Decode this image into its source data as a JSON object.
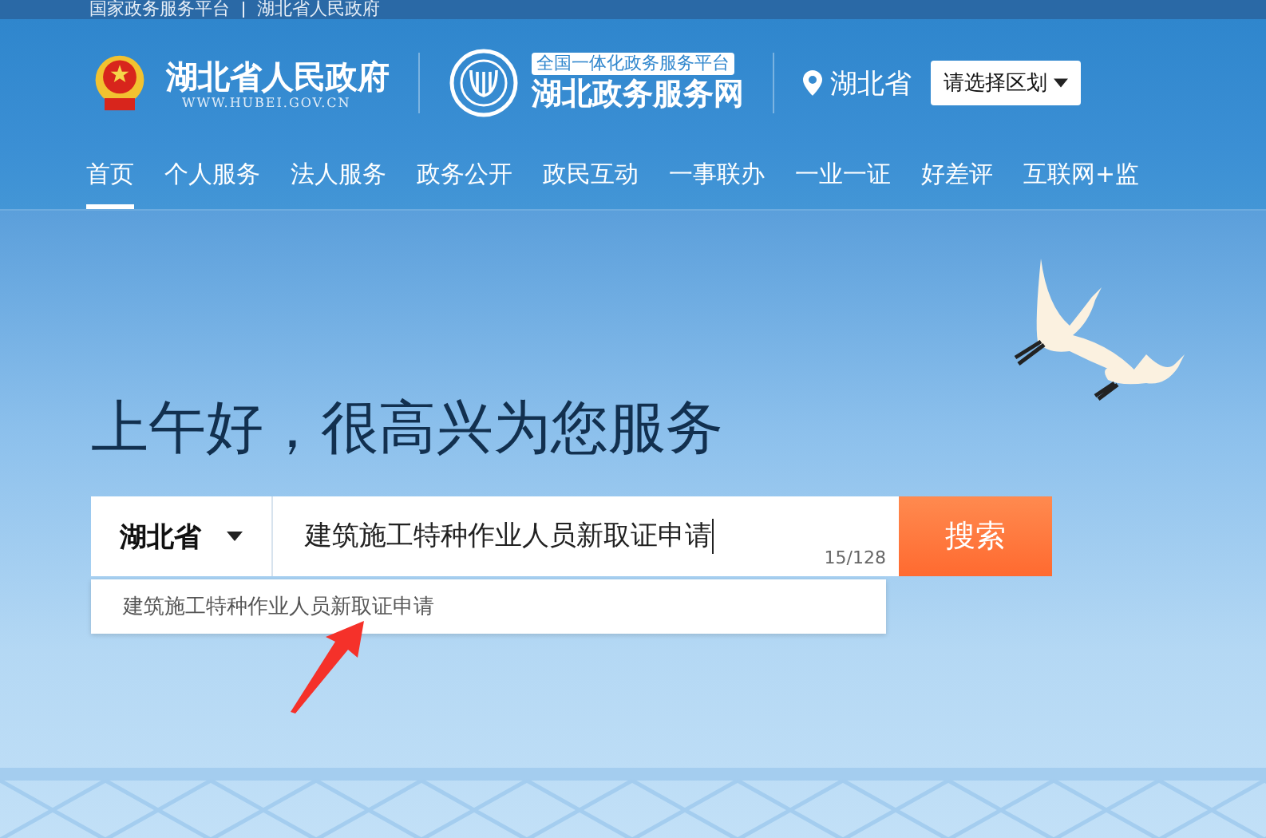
{
  "top_bar": {
    "links": [
      "国家政务服务平台",
      "湖北省人民政府"
    ]
  },
  "header": {
    "gov_name": "湖北省人民政府",
    "gov_url": "WWW.HUBEI.GOV.CN",
    "platform_tag": "全国一体化政务服务平台",
    "platform_name": "湖北政务服务网",
    "location": "湖北省",
    "region_select": "请选择区划"
  },
  "nav": [
    {
      "label": "首页",
      "selected": true
    },
    {
      "label": "个人服务",
      "selected": false
    },
    {
      "label": "法人服务",
      "selected": false
    },
    {
      "label": "政务公开",
      "selected": false
    },
    {
      "label": "政民互动",
      "selected": false
    },
    {
      "label": "一事联办",
      "selected": false
    },
    {
      "label": "一业一证",
      "selected": false
    },
    {
      "label": "好差评",
      "selected": false
    },
    {
      "label": "互联网+监",
      "selected": false
    }
  ],
  "greeting": "上午好，很高兴为您服务",
  "search": {
    "region": "湖北省",
    "value": "建筑施工特种作业人员新取证申请",
    "counter": "15/128",
    "button": "搜索",
    "suggestions": [
      "建筑施工特种作业人员新取证申请"
    ]
  }
}
